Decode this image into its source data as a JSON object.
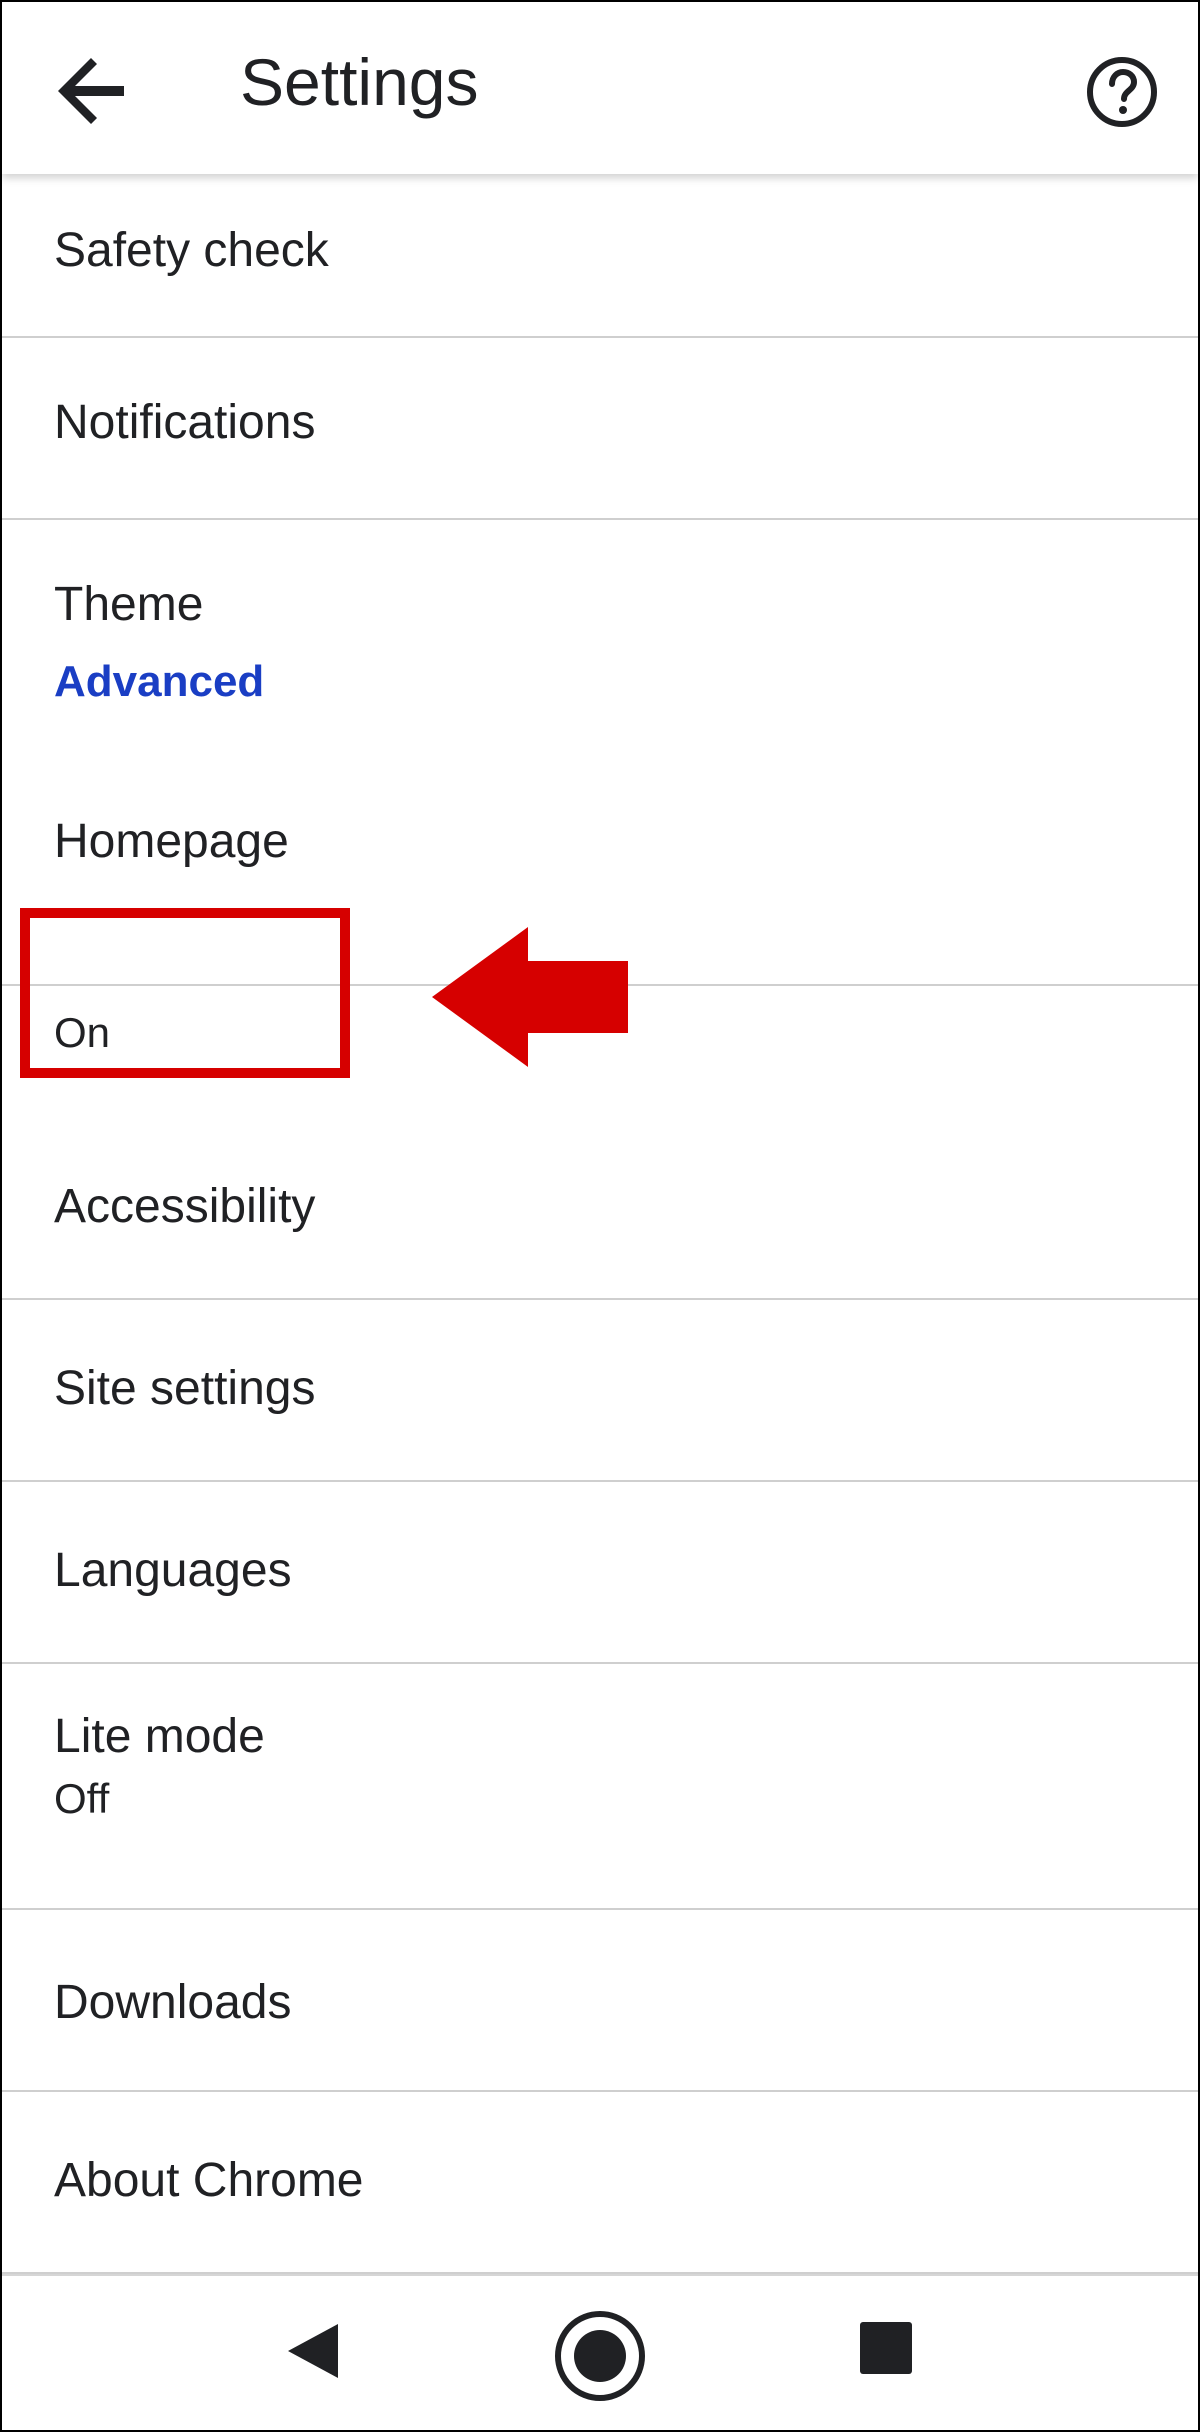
{
  "header": {
    "title": "Settings",
    "back_icon": "arrow-left-icon",
    "help_icon": "help-circle-icon"
  },
  "settings": {
    "safety_check": "Safety check",
    "notifications": "Notifications",
    "theme": "Theme",
    "advanced_header": "Advanced",
    "homepage": {
      "label": "Homepage",
      "value": "On"
    },
    "accessibility": "Accessibility",
    "site_settings": "Site settings",
    "languages": "Languages",
    "lite_mode": {
      "label": "Lite mode",
      "value": "Off"
    },
    "downloads": "Downloads",
    "about_chrome": "About Chrome"
  },
  "annotation": {
    "color": "#d60000",
    "shape": "red-arrow-pointing-left"
  },
  "colors": {
    "accent_blue": "#1a3ec4",
    "text": "#202124",
    "divider": "#cfcfcf"
  },
  "system_nav": {
    "back_icon": "triangle-back-icon",
    "home_icon": "circle-home-icon",
    "recent_icon": "square-recents-icon"
  }
}
